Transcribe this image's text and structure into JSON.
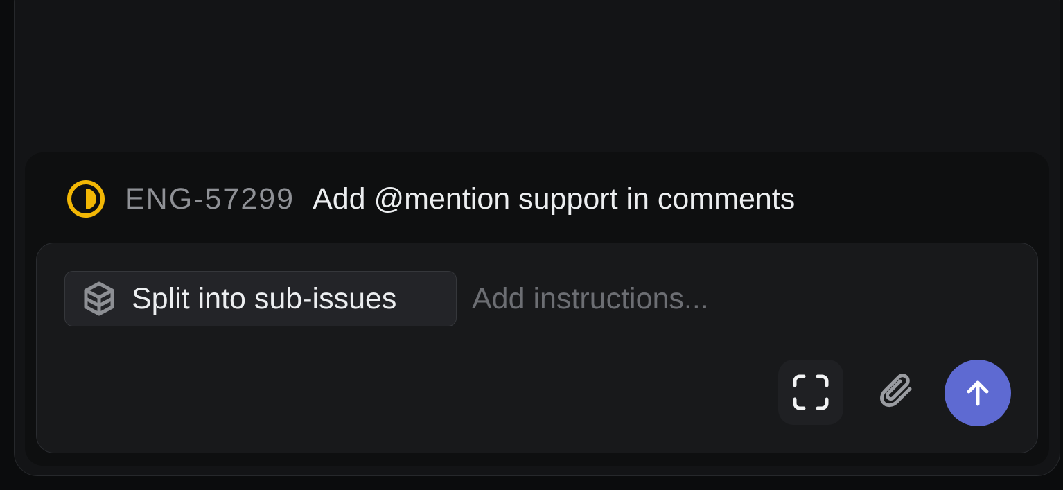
{
  "issue": {
    "id": "ENG-57299",
    "title": "Add @mention support in comments",
    "status_icon": "in-progress-half-circle-icon",
    "status_color": "#f2b705"
  },
  "composer": {
    "chip": {
      "label": "Split into sub-issues",
      "icon": "cube-icon"
    },
    "instructions_placeholder": "Add instructions...",
    "instructions_value": "",
    "scan_icon": "scan-frame-icon",
    "attach_icon": "paperclip-icon",
    "send_icon": "arrow-up-icon",
    "send_color": "#5e6ad2"
  }
}
